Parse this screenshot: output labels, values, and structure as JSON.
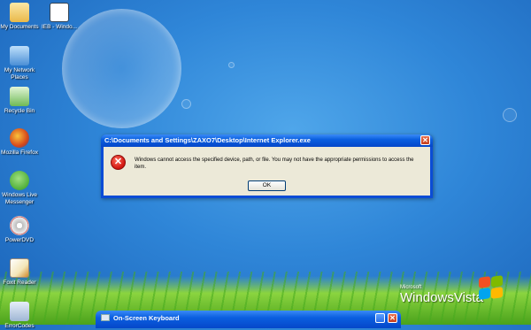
{
  "desktop": {
    "icons": [
      {
        "label": "My Documents",
        "icon": "folder-documents-icon",
        "color": "#f6d36b"
      },
      {
        "label": "IEB - Windo...",
        "icon": "window-shortcut-icon",
        "color": "#e8eef8"
      },
      {
        "label": "My Network Places",
        "icon": "network-places-icon",
        "color": "#7db8e8"
      },
      {
        "label": "Recycle Bin",
        "icon": "recycle-bin-icon",
        "color": "#9fd48a"
      },
      {
        "label": "Mozilla Firefox",
        "icon": "firefox-icon",
        "color": "#e8661c"
      },
      {
        "label": "Windows Live Messenger",
        "icon": "messenger-icon",
        "color": "#4cbf3a"
      },
      {
        "label": "PowerDVD",
        "icon": "powerdvd-icon",
        "color": "#d9d9d9"
      },
      {
        "label": "Foxit Reader",
        "icon": "foxit-reader-icon",
        "color": "#f3e6b8"
      },
      {
        "label": "ErrorCodes",
        "icon": "error-codes-icon",
        "color": "#c9d8ea"
      }
    ]
  },
  "dialog": {
    "title": "C:\\Documents and Settings\\ZAXO7\\Desktop\\Internet Explorer.exe",
    "message": "Windows cannot access the specified device, path, or file.  You may not have the appropriate permissions to access the item.",
    "ok_label": "OK",
    "close_glyph": "✕",
    "error_glyph": "✕"
  },
  "osk": {
    "title": "On-Screen Keyboard",
    "close_glyph": "✕"
  },
  "branding": {
    "microsoft": "Microsoft",
    "product": "WindowsVista"
  }
}
